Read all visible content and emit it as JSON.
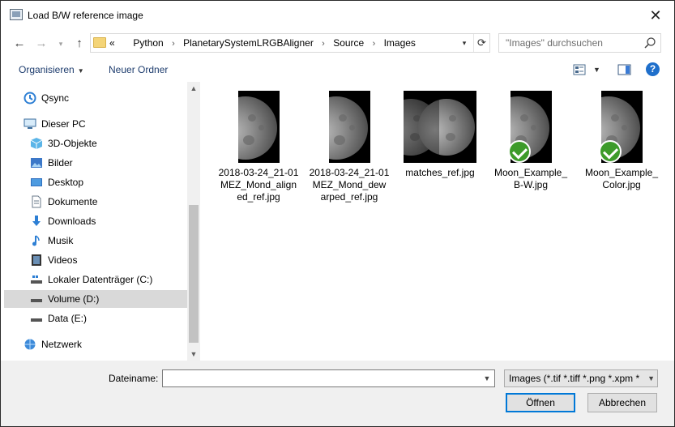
{
  "window": {
    "title": "Load B/W reference image"
  },
  "nav": {
    "back": "←",
    "forward": "→",
    "up": "↑"
  },
  "address": {
    "prefix": "«",
    "crumbs": [
      "Python",
      "PlanetarySystemLRGBAligner",
      "Source",
      "Images"
    ],
    "separator": "›"
  },
  "search": {
    "placeholder": "\"Images\" durchsuchen"
  },
  "toolbar": {
    "organize": "Organisieren",
    "new_folder": "Neuer Ordner",
    "help": "?"
  },
  "sidebar": {
    "items": [
      {
        "label": "Qsync",
        "icon": "qsync-icon"
      },
      {
        "label": "Dieser PC",
        "icon": "pc-icon"
      },
      {
        "label": "3D-Objekte",
        "icon": "cube-icon"
      },
      {
        "label": "Bilder",
        "icon": "pictures-icon"
      },
      {
        "label": "Desktop",
        "icon": "desktop-icon"
      },
      {
        "label": "Dokumente",
        "icon": "document-icon"
      },
      {
        "label": "Downloads",
        "icon": "download-icon"
      },
      {
        "label": "Musik",
        "icon": "music-icon"
      },
      {
        "label": "Videos",
        "icon": "video-icon"
      },
      {
        "label": "Lokaler Datenträger (C:)",
        "icon": "drive-icon"
      },
      {
        "label": "Volume (D:)",
        "icon": "drive-icon"
      },
      {
        "label": "Data (E:)",
        "icon": "drive-icon"
      },
      {
        "label": "Netzwerk",
        "icon": "network-icon"
      }
    ]
  },
  "files": [
    {
      "name": "2018-03-24_21-01MEZ_Mond_aligned_ref.jpg",
      "line1": "2018-03-24_21-01",
      "line2": "MEZ_Mond_align",
      "line3": "ed_ref.jpg",
      "checked": false
    },
    {
      "name": "2018-03-24_21-01MEZ_Mond_dewarped_ref.jpg",
      "line1": "2018-03-24_21-01",
      "line2": "MEZ_Mond_dew",
      "line3": "arped_ref.jpg",
      "checked": false
    },
    {
      "name": "matches_ref.jpg",
      "line1": "matches_ref.jpg",
      "line2": "",
      "line3": "",
      "checked": false
    },
    {
      "name": "Moon_Example_B-W.jpg",
      "line1": "Moon_Example_",
      "line2": "B-W.jpg",
      "line3": "",
      "checked": true
    },
    {
      "name": "Moon_Example_Color.jpg",
      "line1": "Moon_Example_",
      "line2": "Color.jpg",
      "line3": "",
      "checked": true
    }
  ],
  "footer": {
    "filename_label": "Dateiname:",
    "filename_value": "",
    "filter": "Images (*.tif *.tiff *.png *.xpm *",
    "open": "Öffnen",
    "cancel": "Abbrechen"
  },
  "colors": {
    "accent": "#0078d7",
    "selected_bg": "#d9d9d9",
    "check_green": "#3d9b2a"
  }
}
